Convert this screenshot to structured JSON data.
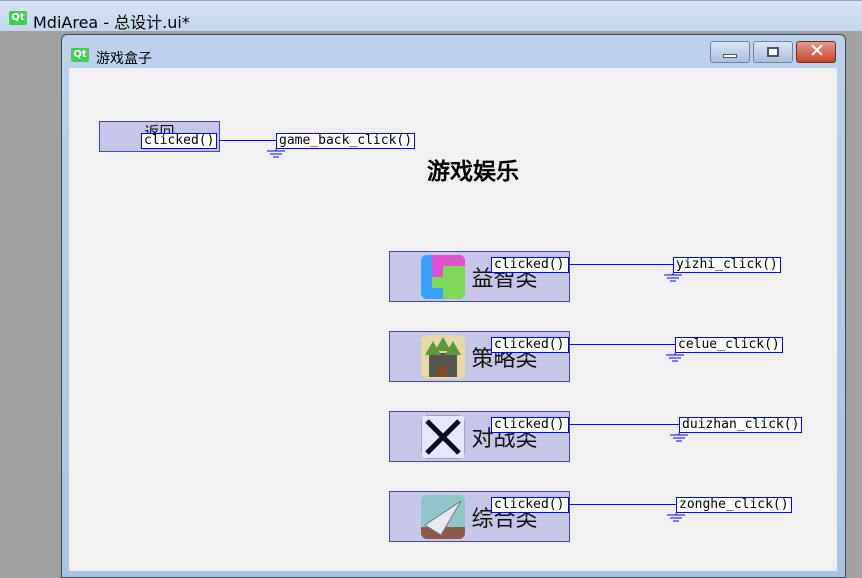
{
  "app": {
    "title": "MdiArea - 总设计.ui*",
    "logo": "Qt"
  },
  "window": {
    "title": "游戏盒子",
    "logo": "Qt",
    "controls": [
      "minimize-icon",
      "maximize-icon",
      "close-icon"
    ]
  },
  "form": {
    "back_button": "返回",
    "heading": "游戏娱乐",
    "categories": [
      {
        "label": "益智类",
        "icon": "puzzle-icon",
        "signal": "clicked()",
        "slot": "yizhi_click()"
      },
      {
        "label": "策略类",
        "icon": "castle-icon",
        "signal": "clicked()",
        "slot": "celue_click()"
      },
      {
        "label": "对战类",
        "icon": "crossed-swords-icon",
        "signal": "clicked()",
        "slot": "duizhan_click()"
      },
      {
        "label": "综合类",
        "icon": "paper-plane-icon",
        "signal": "clicked()",
        "slot": "zonghe_click()"
      }
    ],
    "back_connection": {
      "signal": "clicked()",
      "slot": "game_back_click()"
    }
  },
  "colors": {
    "connection": "#0000ff",
    "button_bg": "#c6c6e6"
  }
}
